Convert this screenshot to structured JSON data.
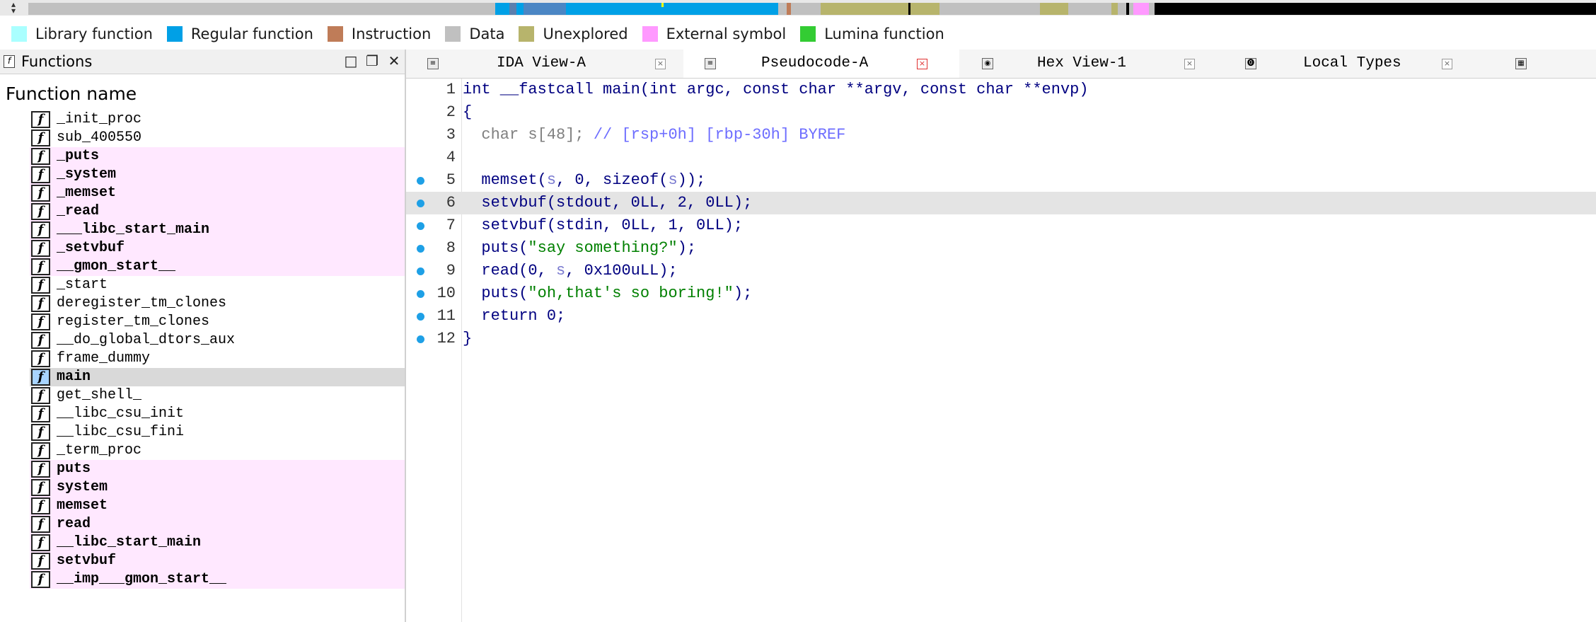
{
  "legend": [
    {
      "label": "Library function",
      "color": "#aaffff"
    },
    {
      "label": "Regular function",
      "color": "#00a0e6"
    },
    {
      "label": "Instruction",
      "color": "#bf7c58"
    },
    {
      "label": "Data",
      "color": "#c0c0c0"
    },
    {
      "label": "Unexplored",
      "color": "#b7b46c"
    },
    {
      "label": "External symbol",
      "color": "#ff99ff"
    },
    {
      "label": "Lumina function",
      "color": "#33cc33"
    }
  ],
  "functions_panel": {
    "title": "Functions",
    "column_header": "Function name",
    "items": [
      {
        "name": "_init_proc",
        "type": "regular"
      },
      {
        "name": "sub_400550",
        "type": "regular"
      },
      {
        "name": "_puts",
        "type": "external"
      },
      {
        "name": "_system",
        "type": "external"
      },
      {
        "name": "_memset",
        "type": "external"
      },
      {
        "name": "_read",
        "type": "external"
      },
      {
        "name": "___libc_start_main",
        "type": "external"
      },
      {
        "name": "_setvbuf",
        "type": "external"
      },
      {
        "name": "__gmon_start__",
        "type": "external"
      },
      {
        "name": "_start",
        "type": "regular"
      },
      {
        "name": "deregister_tm_clones",
        "type": "regular"
      },
      {
        "name": "register_tm_clones",
        "type": "regular"
      },
      {
        "name": "__do_global_dtors_aux",
        "type": "regular"
      },
      {
        "name": "frame_dummy",
        "type": "regular"
      },
      {
        "name": "main",
        "type": "selected"
      },
      {
        "name": "get_shell_",
        "type": "regular"
      },
      {
        "name": "__libc_csu_init",
        "type": "regular"
      },
      {
        "name": "__libc_csu_fini",
        "type": "regular"
      },
      {
        "name": "_term_proc",
        "type": "regular"
      },
      {
        "name": "puts",
        "type": "external"
      },
      {
        "name": "system",
        "type": "external"
      },
      {
        "name": "memset",
        "type": "external"
      },
      {
        "name": "read",
        "type": "external"
      },
      {
        "name": "__libc_start_main",
        "type": "external"
      },
      {
        "name": "setvbuf",
        "type": "external"
      },
      {
        "name": "__imp___gmon_start__",
        "type": "external"
      }
    ]
  },
  "tabs": [
    {
      "label": "IDA View-A",
      "active": false
    },
    {
      "label": "Pseudocode-A",
      "active": true
    },
    {
      "label": "Hex View-1",
      "active": false
    },
    {
      "label": "Local Types",
      "active": false
    }
  ],
  "code": {
    "highlighted_line": 6,
    "lines": [
      {
        "num": "1",
        "bp": false,
        "segments": [
          {
            "t": "int __fastcall main(int argc, const char **argv, const char **envp)",
            "c": ""
          }
        ]
      },
      {
        "num": "2",
        "bp": false,
        "segments": [
          {
            "t": "{",
            "c": ""
          }
        ]
      },
      {
        "num": "3",
        "bp": false,
        "segments": [
          {
            "t": "  char s[48]; ",
            "c": "c-dim"
          },
          {
            "t": "// [rsp+0h] [rbp-30h] BYREF",
            "c": "c-com"
          }
        ]
      },
      {
        "num": "4",
        "bp": false,
        "segments": [
          {
            "t": "",
            "c": ""
          }
        ]
      },
      {
        "num": "5",
        "bp": true,
        "segments": [
          {
            "t": "  memset(",
            "c": ""
          },
          {
            "t": "s",
            "c": "c-var"
          },
          {
            "t": ", 0, sizeof(",
            "c": ""
          },
          {
            "t": "s",
            "c": "c-var"
          },
          {
            "t": "));",
            "c": ""
          }
        ]
      },
      {
        "num": "6",
        "bp": true,
        "segments": [
          {
            "t": "  setvbuf(stdout, 0LL, 2, 0LL);",
            "c": ""
          }
        ]
      },
      {
        "num": "7",
        "bp": true,
        "segments": [
          {
            "t": "  setvbuf(stdin, 0LL, 1, 0LL);",
            "c": ""
          }
        ]
      },
      {
        "num": "8",
        "bp": true,
        "segments": [
          {
            "t": "  puts(",
            "c": ""
          },
          {
            "t": "\"say something?\"",
            "c": "c-str"
          },
          {
            "t": ");",
            "c": ""
          }
        ]
      },
      {
        "num": "9",
        "bp": true,
        "segments": [
          {
            "t": "  read(0, ",
            "c": ""
          },
          {
            "t": "s",
            "c": "c-var"
          },
          {
            "t": ", 0x100uLL);",
            "c": ""
          }
        ]
      },
      {
        "num": "10",
        "bp": true,
        "segments": [
          {
            "t": "  puts(",
            "c": ""
          },
          {
            "t": "\"oh,that's so boring!\"",
            "c": "c-str"
          },
          {
            "t": ");",
            "c": ""
          }
        ]
      },
      {
        "num": "11",
        "bp": true,
        "segments": [
          {
            "t": "  return 0;",
            "c": ""
          }
        ]
      },
      {
        "num": "12",
        "bp": true,
        "segments": [
          {
            "t": "}",
            "c": ""
          }
        ]
      }
    ]
  }
}
